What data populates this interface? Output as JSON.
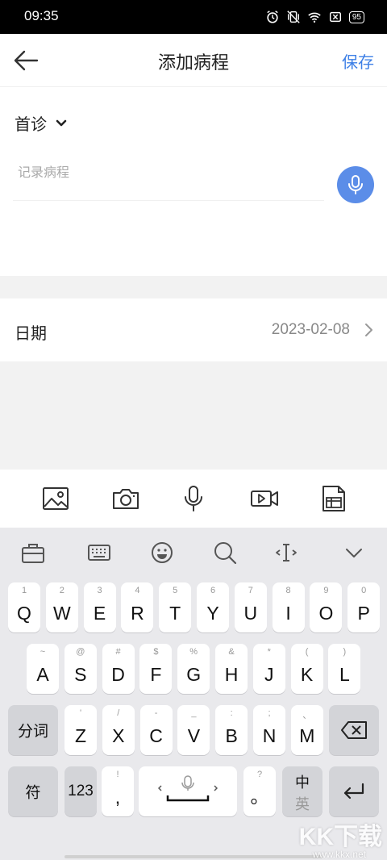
{
  "status_bar": {
    "time": "09:35",
    "battery": "95"
  },
  "header": {
    "title": "添加病程",
    "save_label": "保存",
    "accent": "#3d7fe6"
  },
  "record": {
    "visit_type": "首诊",
    "placeholder": "记录病程",
    "mic_color": "#5b8de8"
  },
  "date_row": {
    "label": "日期",
    "value": "2023-02-08"
  },
  "media_toolbar": [
    "image-icon",
    "camera-icon",
    "microphone-icon",
    "video-icon",
    "document-icon"
  ],
  "keyboard": {
    "toolbar": [
      "toolbox-icon",
      "keyboard-icon",
      "emoji-icon",
      "search-icon",
      "cursor-icon",
      "collapse-icon"
    ],
    "row1": [
      {
        "k": "Q",
        "s": "1"
      },
      {
        "k": "W",
        "s": "2"
      },
      {
        "k": "E",
        "s": "3"
      },
      {
        "k": "R",
        "s": "4"
      },
      {
        "k": "T",
        "s": "5"
      },
      {
        "k": "Y",
        "s": "6"
      },
      {
        "k": "U",
        "s": "7"
      },
      {
        "k": "I",
        "s": "8"
      },
      {
        "k": "O",
        "s": "9"
      },
      {
        "k": "P",
        "s": "0"
      }
    ],
    "row2": [
      {
        "k": "A",
        "s": "~"
      },
      {
        "k": "S",
        "s": "@"
      },
      {
        "k": "D",
        "s": "#"
      },
      {
        "k": "F",
        "s": "$"
      },
      {
        "k": "G",
        "s": "%"
      },
      {
        "k": "H",
        "s": "&"
      },
      {
        "k": "J",
        "s": "*"
      },
      {
        "k": "K",
        "s": "("
      },
      {
        "k": "L",
        "s": ")"
      }
    ],
    "row3": [
      {
        "k": "Z",
        "s": "'"
      },
      {
        "k": "X",
        "s": "/"
      },
      {
        "k": "C",
        "s": "-"
      },
      {
        "k": "V",
        "s": "_"
      },
      {
        "k": "B",
        "s": ":"
      },
      {
        "k": "N",
        "s": ";"
      },
      {
        "k": "M",
        "s": "、"
      }
    ],
    "fenci": "分词",
    "fu": "符",
    "num": "123",
    "comma": {
      "k": ",",
      "s": "!"
    },
    "period": {
      "k": "。",
      "s": "?"
    },
    "lang_zh": "中",
    "lang_en": "英"
  },
  "watermark": {
    "text": "KK下载",
    "sub": "www.kkx.net"
  }
}
